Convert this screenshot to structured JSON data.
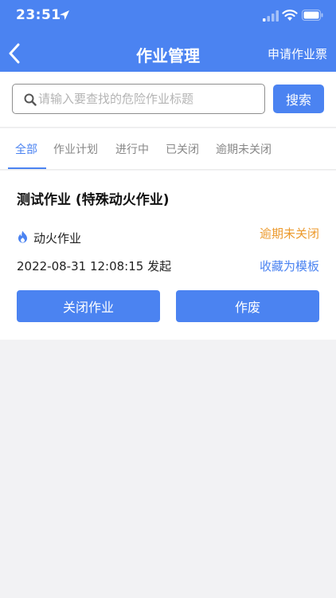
{
  "status_bar": {
    "time": "23:51"
  },
  "nav": {
    "title": "作业管理",
    "action_label": "申请作业票"
  },
  "search": {
    "placeholder": "请输入要查找的危险作业标题",
    "value": "",
    "button_label": "搜索"
  },
  "tabs": [
    {
      "label": "全部",
      "active": true
    },
    {
      "label": "作业计划",
      "active": false
    },
    {
      "label": "进行中",
      "active": false
    },
    {
      "label": "已关闭",
      "active": false
    },
    {
      "label": "逾期未关闭",
      "active": false
    }
  ],
  "card": {
    "title": "测试作业 (特殊动火作业)",
    "type_icon": "fire-icon",
    "type_label": "动火作业",
    "status": "逾期未关闭",
    "datetime": "2022-08-31 12:08:15 发起",
    "save_template_label": "收藏为模板",
    "close_button_label": "关闭作业",
    "void_button_label": "作废"
  },
  "colors": {
    "primary": "#4b83f1",
    "warning": "#ec9a2d",
    "background": "#f2f2f4"
  }
}
